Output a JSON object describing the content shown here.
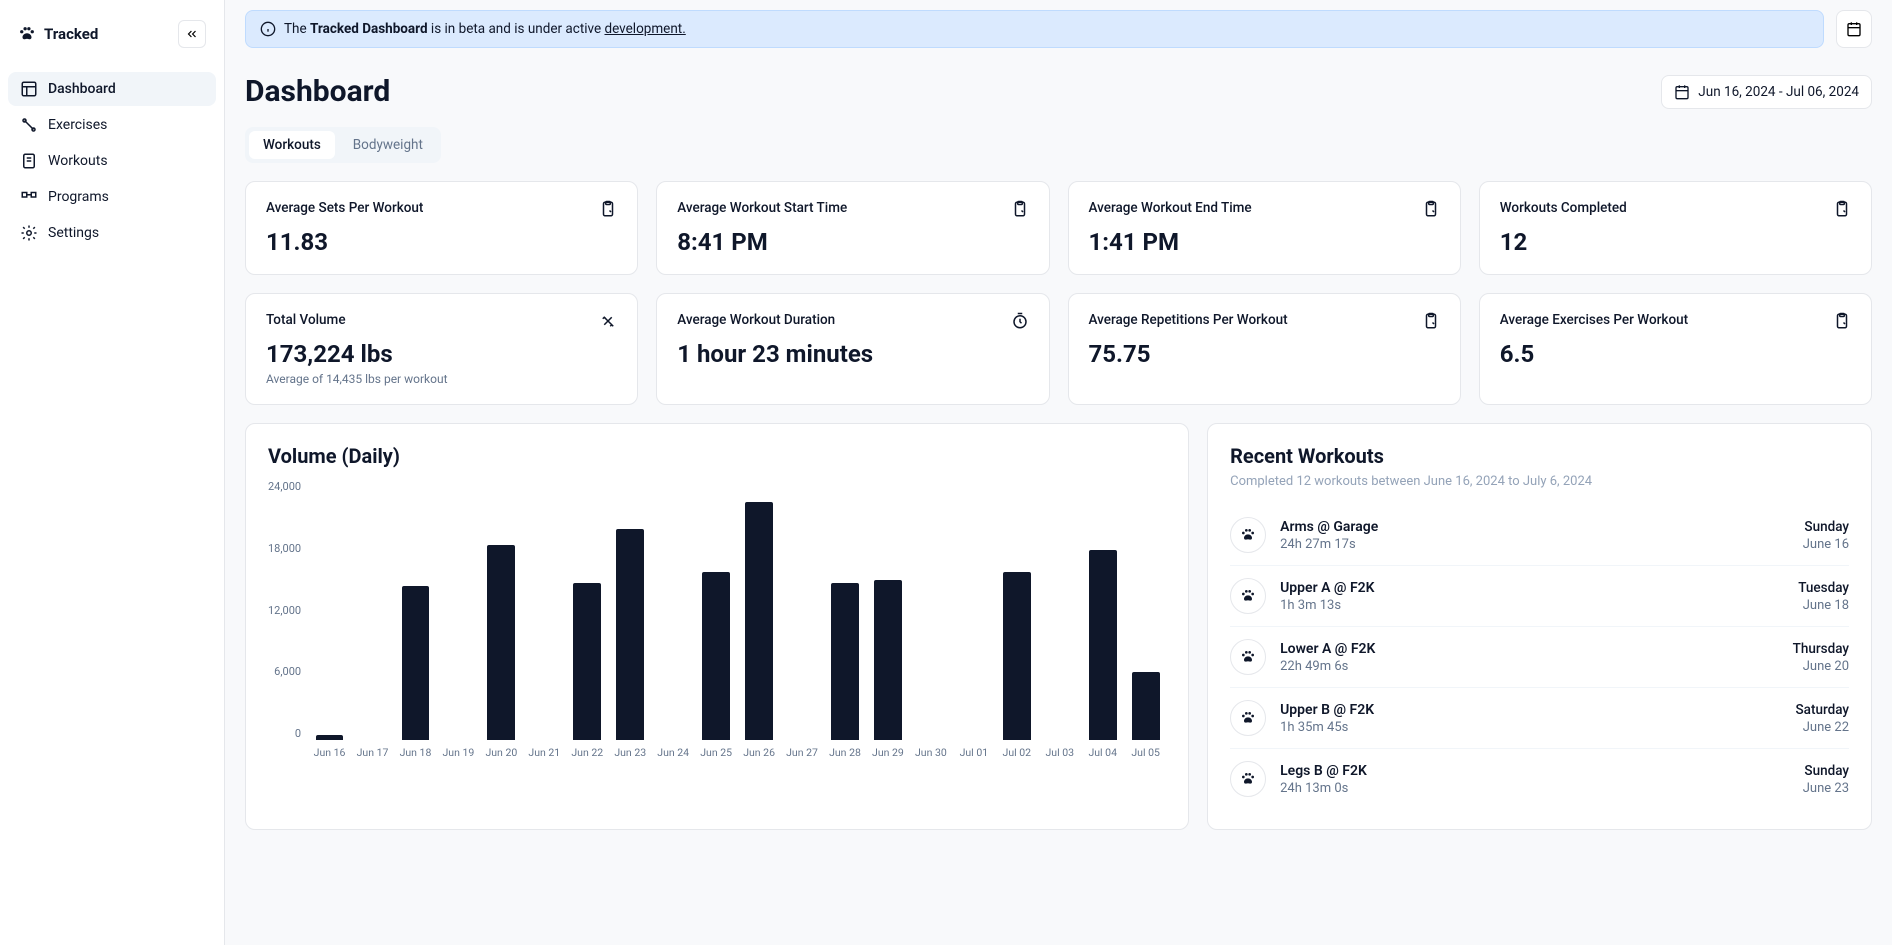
{
  "app": {
    "name": "Tracked"
  },
  "nav": {
    "items": [
      {
        "label": "Dashboard",
        "active": true
      },
      {
        "label": "Exercises",
        "active": false
      },
      {
        "label": "Workouts",
        "active": false
      },
      {
        "label": "Programs",
        "active": false
      },
      {
        "label": "Settings",
        "active": false
      }
    ]
  },
  "banner": {
    "prefix": "The ",
    "bold": "Tracked Dashboard",
    "middle": " is in beta and is under active ",
    "link": "development."
  },
  "header": {
    "title": "Dashboard",
    "date_range": "Jun 16, 2024 - Jul 06, 2024"
  },
  "tabs": [
    {
      "label": "Workouts",
      "active": true
    },
    {
      "label": "Bodyweight",
      "active": false
    }
  ],
  "cards": [
    {
      "label": "Average Sets Per Workout",
      "value": "11.83",
      "icon": "clipboard"
    },
    {
      "label": "Average Workout Start Time",
      "value": "8:41 PM",
      "icon": "clipboard"
    },
    {
      "label": "Average Workout End Time",
      "value": "1:41 PM",
      "icon": "clipboard"
    },
    {
      "label": "Workouts Completed",
      "value": "12",
      "icon": "clipboard"
    },
    {
      "label": "Total Volume",
      "value": "173,224 lbs",
      "sub": "Average of 14,435 lbs per workout",
      "icon": "arrows"
    },
    {
      "label": "Average Workout Duration",
      "value": "1 hour 23 minutes",
      "icon": "stopwatch"
    },
    {
      "label": "Average Repetitions Per Workout",
      "value": "75.75",
      "icon": "clipboard"
    },
    {
      "label": "Average Exercises Per Workout",
      "value": "6.5",
      "icon": "clipboard"
    }
  ],
  "chart_data": {
    "type": "bar",
    "title": "Volume (Daily)",
    "categories": [
      "Jun 16",
      "Jun 17",
      "Jun 18",
      "Jun 19",
      "Jun 20",
      "Jun 21",
      "Jun 22",
      "Jun 23",
      "Jun 24",
      "Jun 25",
      "Jun 26",
      "Jun 27",
      "Jun 28",
      "Jun 29",
      "Jun 30",
      "Jul 01",
      "Jul 02",
      "Jul 03",
      "Jul 04",
      "Jul 05"
    ],
    "values": [
      500,
      0,
      14200,
      0,
      18000,
      0,
      14500,
      19500,
      0,
      15500,
      22000,
      0,
      14500,
      14800,
      0,
      0,
      15500,
      0,
      17500,
      6300
    ],
    "ylabel": "",
    "xlabel": "",
    "ylim": [
      0,
      24000
    ],
    "y_ticks": [
      "24,000",
      "18,000",
      "12,000",
      "6,000",
      "0"
    ]
  },
  "recent": {
    "title": "Recent Workouts",
    "subtitle": "Completed 12 workouts between June 16, 2024 to July 6, 2024",
    "items": [
      {
        "name": "Arms @ Garage",
        "duration": "24h 27m 17s",
        "day": "Sunday",
        "date": "June 16"
      },
      {
        "name": "Upper A @ F2K",
        "duration": "1h 3m 13s",
        "day": "Tuesday",
        "date": "June 18"
      },
      {
        "name": "Lower A @ F2K",
        "duration": "22h 49m 6s",
        "day": "Thursday",
        "date": "June 20"
      },
      {
        "name": "Upper B @ F2K",
        "duration": "1h 35m 45s",
        "day": "Saturday",
        "date": "June 22"
      },
      {
        "name": "Legs B @ F2K",
        "duration": "24h 13m 0s",
        "day": "Sunday",
        "date": "June 23"
      }
    ]
  }
}
